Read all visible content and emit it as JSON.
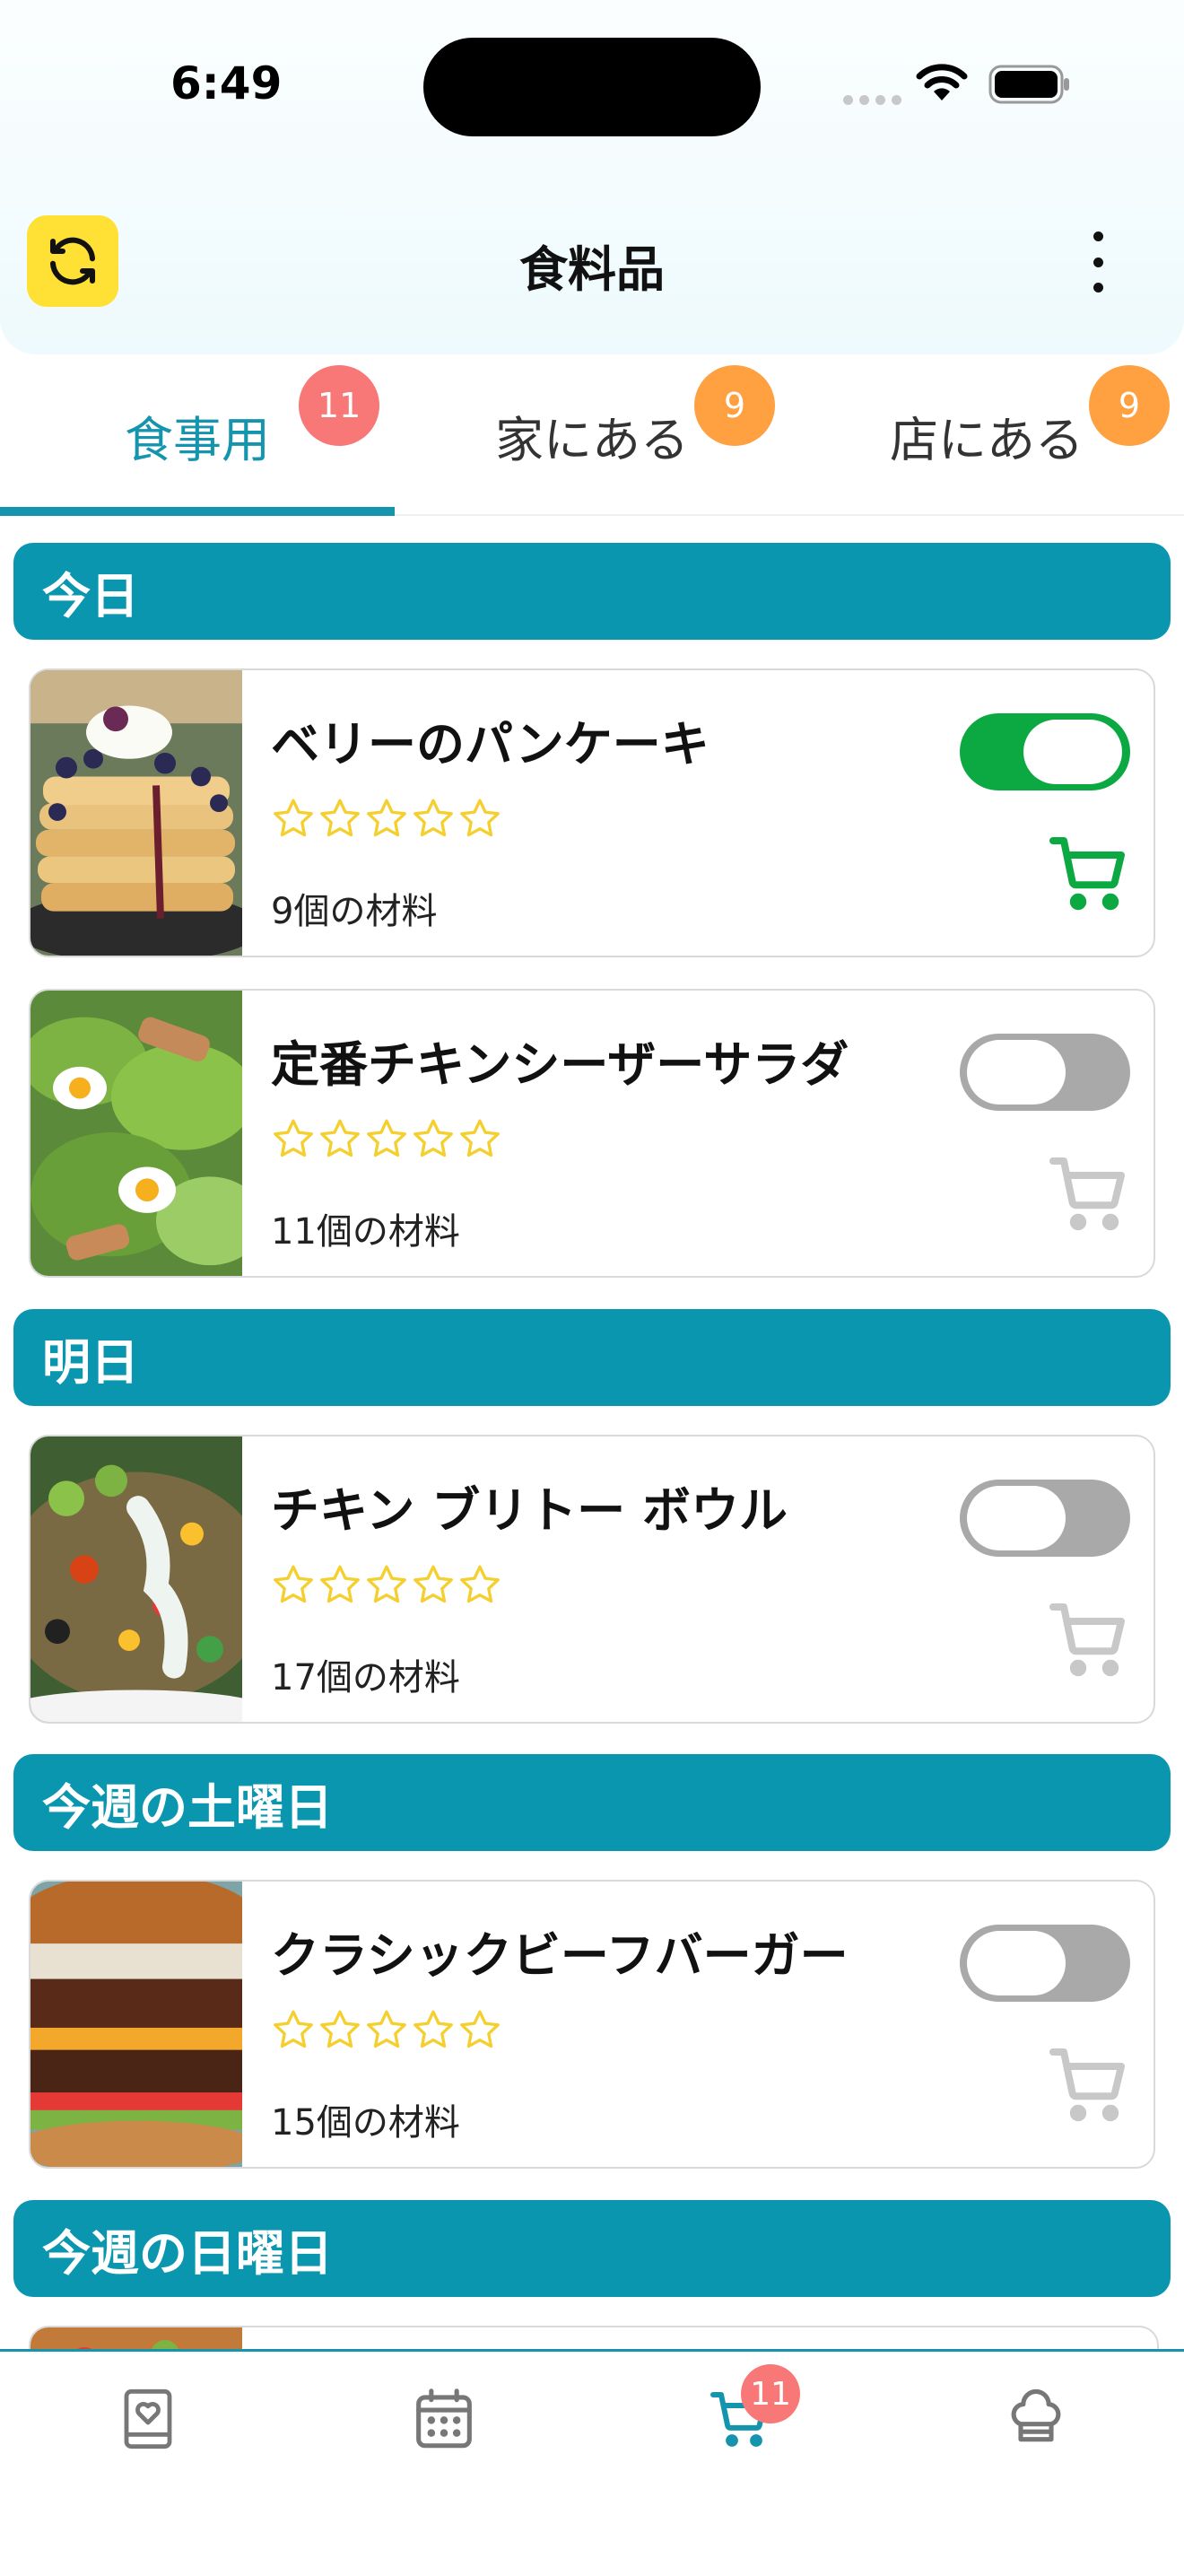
{
  "status_bar": {
    "time": "6:49"
  },
  "header": {
    "title": "食料品"
  },
  "tabs": [
    {
      "label": "食事用",
      "badge": "11",
      "active": true,
      "badge_color": "#f87777"
    },
    {
      "label": "家にある",
      "badge": "9",
      "active": false,
      "badge_color": "#ffa041"
    },
    {
      "label": "店にある",
      "badge": "9",
      "active": false,
      "badge_color": "#ffa041"
    }
  ],
  "sections": [
    {
      "label": "今日"
    },
    {
      "label": "明日"
    },
    {
      "label": "今週の土曜日"
    },
    {
      "label": "今週の日曜日"
    }
  ],
  "meals": [
    {
      "title": "ベリーのパンケーキ",
      "ingredients": "9個の材料",
      "in_cart": true,
      "rating": 0,
      "icon": "pancake-photo"
    },
    {
      "title": "定番チキンシーザーサラダ",
      "ingredients": "11個の材料",
      "in_cart": false,
      "rating": 0,
      "icon": "salad-photo"
    },
    {
      "title": "チキン ブリトー ボウル",
      "ingredients": "17個の材料",
      "in_cart": false,
      "rating": 0,
      "icon": "burrito-bowl-photo"
    },
    {
      "title": "クラシックビーフバーガー",
      "ingredients": "15個の材料",
      "in_cart": false,
      "rating": 0,
      "icon": "burger-photo"
    }
  ],
  "bottom_nav": {
    "items": [
      {
        "name": "recipes",
        "icon": "recipe-book-icon",
        "active": false
      },
      {
        "name": "calendar",
        "icon": "calendar-icon",
        "active": false
      },
      {
        "name": "grocery",
        "icon": "cart-icon",
        "active": true,
        "badge": "11"
      },
      {
        "name": "chef",
        "icon": "chef-hat-icon",
        "active": false
      }
    ]
  },
  "colors": {
    "accent": "#1595ad",
    "section_header": "#0b96b0",
    "toggle_on": "#0ca842",
    "toggle_off": "#a9a9a9",
    "star": "#f5cf2e",
    "sync_button": "#ffe034"
  }
}
